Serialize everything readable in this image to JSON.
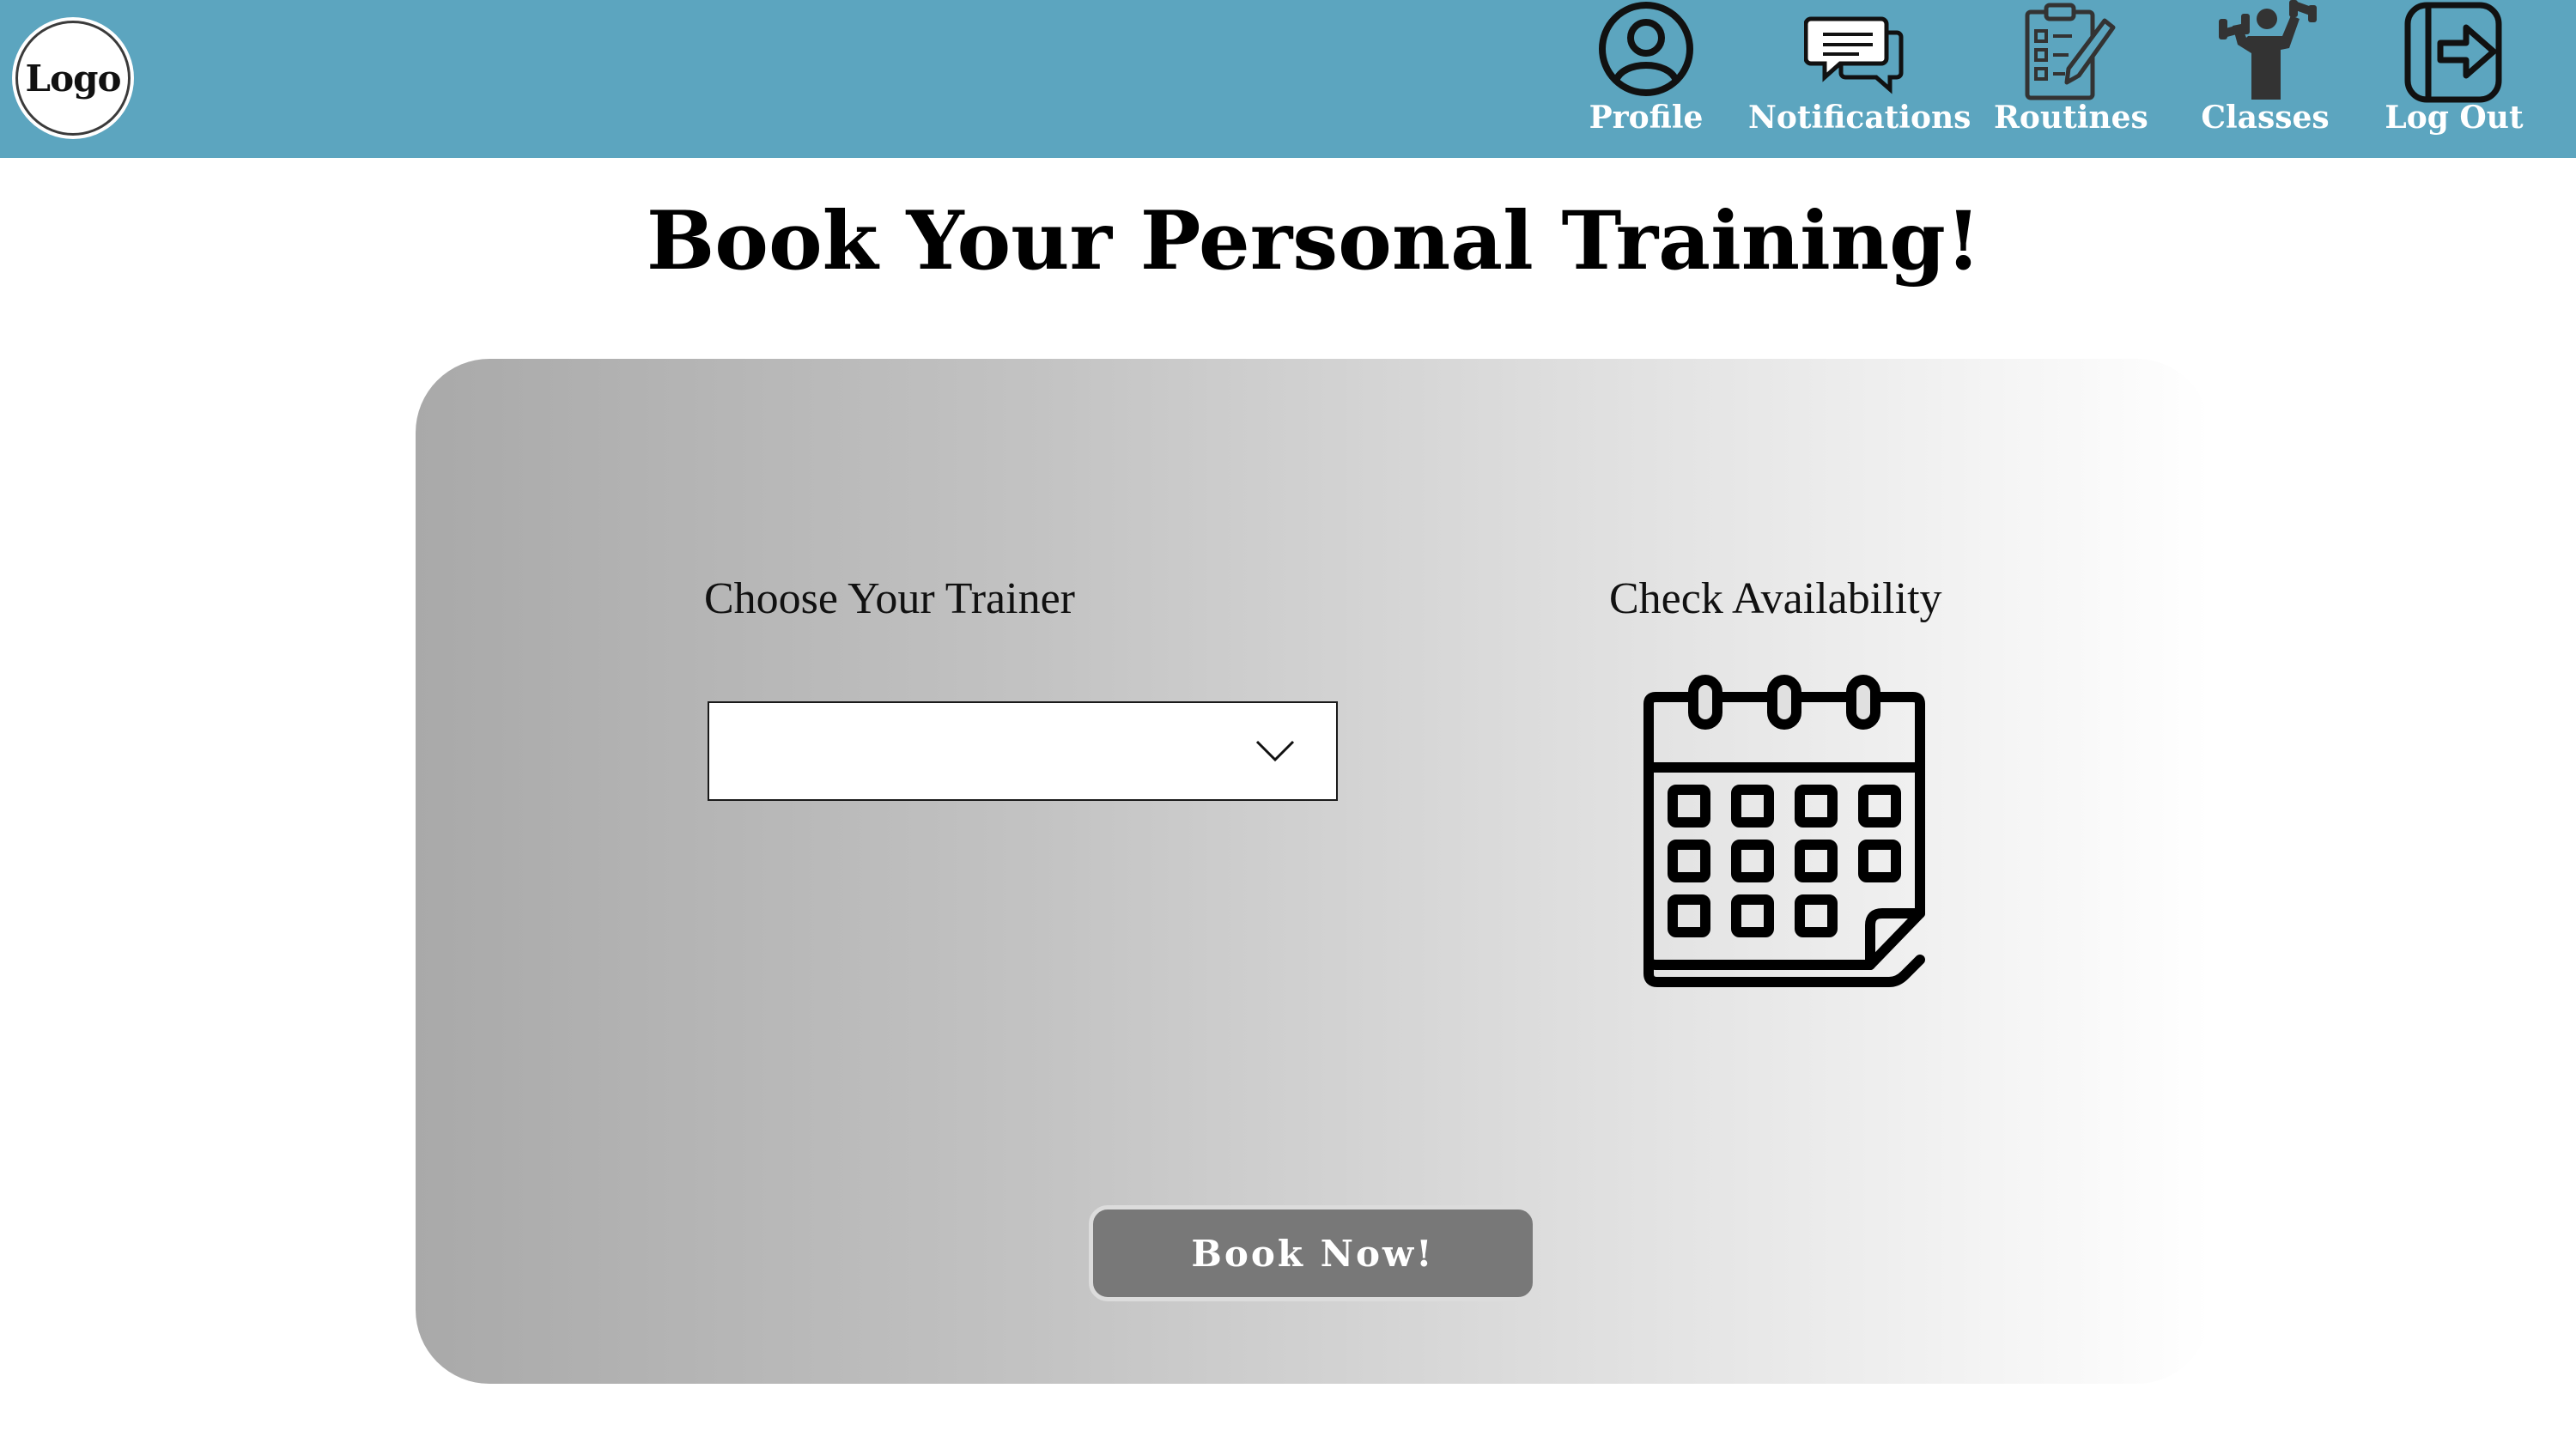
{
  "header": {
    "logo_text": "Logo",
    "background_color": "#5ca5bf",
    "nav": [
      {
        "label": "Profile",
        "icon": "user-circle-icon"
      },
      {
        "label": "Notifications",
        "icon": "chat-bubbles-icon"
      },
      {
        "label": "Routines",
        "icon": "clipboard-checklist-icon"
      },
      {
        "label": "Classes",
        "icon": "weightlifter-icon"
      },
      {
        "label": "Log Out",
        "icon": "logout-icon"
      }
    ]
  },
  "main": {
    "title": "Book Your Personal Training!",
    "trainer": {
      "label": "Choose Your Trainer",
      "selected_value": ""
    },
    "availability": {
      "label": "Check Availability",
      "icon": "calendar-icon"
    },
    "book_button_label": "Book Now!"
  },
  "colors": {
    "header": "#5ca5bf",
    "button": "#787878",
    "card_gradient_start": "#a9a9a9",
    "card_gradient_end": "#ffffff"
  }
}
